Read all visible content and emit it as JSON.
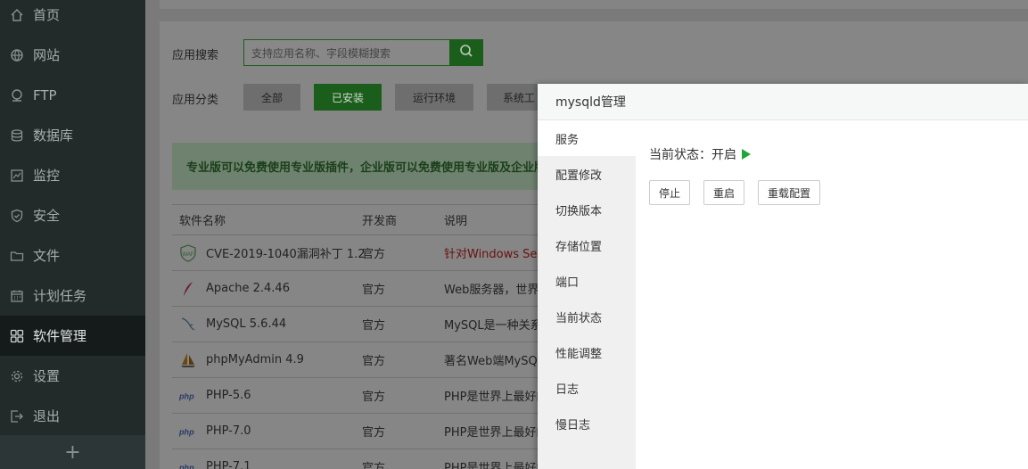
{
  "sidebar": {
    "items": [
      {
        "label": "首页",
        "icon": "home-icon"
      },
      {
        "label": "网站",
        "icon": "globe-icon"
      },
      {
        "label": "FTP",
        "icon": "ftp-icon"
      },
      {
        "label": "数据库",
        "icon": "database-icon"
      },
      {
        "label": "监控",
        "icon": "monitor-icon"
      },
      {
        "label": "安全",
        "icon": "shield-icon"
      },
      {
        "label": "文件",
        "icon": "folder-icon"
      },
      {
        "label": "计划任务",
        "icon": "calendar-icon"
      },
      {
        "label": "软件管理",
        "icon": "apps-icon"
      },
      {
        "label": "设置",
        "icon": "gear-icon"
      },
      {
        "label": "退出",
        "icon": "logout-icon"
      }
    ],
    "active": "软件管理",
    "add_label": "+"
  },
  "search": {
    "label": "应用搜索",
    "placeholder": "支持应用名称、字段模糊搜索"
  },
  "category": {
    "label": "应用分类",
    "buttons": [
      "全部",
      "已安装",
      "运行环境",
      "系统工"
    ],
    "active": "已安装"
  },
  "notice": "专业版可以免费使用专业版插件，企业版可以免费使用专业版及企业版",
  "table": {
    "headers": [
      "软件名称",
      "开发商",
      "说明"
    ],
    "rows": [
      {
        "name": "CVE-2019-1040漏洞补丁 1.2",
        "dev": "官方",
        "desc": "针对Windows Serv",
        "icon": "waf-icon"
      },
      {
        "name": "Apache 2.4.46",
        "dev": "官方",
        "desc": "Web服务器，世界排",
        "icon": "apache-feather-icon"
      },
      {
        "name": "MySQL 5.6.44",
        "dev": "官方",
        "desc": "MySQL是一种关系数",
        "icon": "mysql-dolphin-icon"
      },
      {
        "name": "phpMyAdmin 4.9",
        "dev": "官方",
        "desc": "著名Web端MySQL",
        "icon": "phpmyadmin-sail-icon"
      },
      {
        "name": "PHP-5.6",
        "dev": "官方",
        "desc": "PHP是世界上最好的",
        "icon": "php-icon"
      },
      {
        "name": "PHP-7.0",
        "dev": "官方",
        "desc": "PHP是世界上最好的",
        "icon": "php-icon"
      },
      {
        "name": "PHP-7.1",
        "dev": "官方",
        "desc": "PHP是世界上最好的",
        "icon": "php-icon"
      }
    ]
  },
  "modal": {
    "title": "mysqld管理",
    "tabs": [
      "服务",
      "配置修改",
      "切换版本",
      "存储位置",
      "端口",
      "当前状态",
      "性能调整",
      "日志",
      "慢日志"
    ],
    "active_tab": "服务",
    "status_label": "当前状态：开启",
    "buttons": [
      "停止",
      "重启",
      "重载配置"
    ]
  },
  "colors": {
    "accent": "#20a53a",
    "sidebar_bg": "#222a2a"
  }
}
